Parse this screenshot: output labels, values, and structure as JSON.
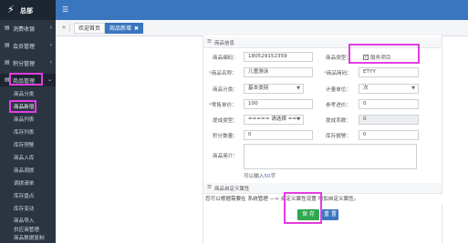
{
  "sidebar": {
    "brand": "总部",
    "menu": [
      {
        "label": "消费收银",
        "icon": "cash-icon"
      },
      {
        "label": "会员管理",
        "icon": "member-icon"
      },
      {
        "label": "积分管理",
        "icon": "points-icon"
      },
      {
        "label": "商品管理",
        "icon": "goods-icon"
      }
    ],
    "submenu": [
      "商品分类",
      "商品新增",
      "商品列表",
      "库存列表",
      "库存预警",
      "商品入库",
      "商品调拨",
      "调拨请单",
      "库存盘点",
      "库存变动",
      "商品导入",
      "供应商管理",
      "商品数据复制"
    ]
  },
  "tabs": {
    "items": [
      {
        "label": "欢迎首页"
      },
      {
        "label": "商品新增",
        "close": "✖"
      }
    ]
  },
  "form": {
    "section_info": "商品信息",
    "code_label": "商品编码：",
    "code_value": "180529152359",
    "type_label": "商品类型：",
    "service_item_label": "服务项目",
    "name_label": "商品名称：",
    "name_value": "儿童游泳",
    "shortcode_label": "商品简码：",
    "shortcode_value": "ETYY",
    "category_label": "商品分类：",
    "category_value": "基本类别",
    "unit_label": "计量单位：",
    "unit_value": "次",
    "price_label": "零售单价：",
    "price_value": "100",
    "refprice_label": "参考进价：",
    "refprice_value": "0",
    "commission_type_label": "提成类型：",
    "commission_type_value": "===== 请选择 ===",
    "commission_rate_label": "提成系数：",
    "commission_rate_value": "0",
    "points_label": "积分数量：",
    "points_value": "0",
    "stock_warn_label": "库存报警：",
    "stock_warn_value": "0",
    "intro_label": "商品简介：",
    "intro_hint_prefix": "可以输入",
    "intro_hint_num": "50",
    "intro_hint_suffix": "字",
    "section_custom": "商品自定义属性",
    "custom_info": "您可以根据需要在 系统管理 —> 自定义属性设置 增加自定义属性。",
    "save_label": "保 存",
    "reset_label": "重 置"
  }
}
